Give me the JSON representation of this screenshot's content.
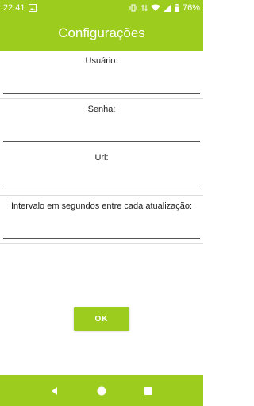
{
  "status_bar": {
    "time": "22:41",
    "battery": "76%",
    "icons": [
      "image-notification-icon",
      "vibrate-icon",
      "lte-signal-icon",
      "wifi-icon",
      "cell-signal-icon",
      "battery-icon"
    ]
  },
  "app_bar": {
    "title": "Configurações"
  },
  "form": {
    "fields": [
      {
        "label": "Usuário:",
        "value": ""
      },
      {
        "label": "Senha:",
        "value": ""
      },
      {
        "label": "Url:",
        "value": ""
      },
      {
        "label": "Intervalo em segundos entre cada atualização:",
        "value": ""
      }
    ],
    "ok_label": "OK"
  },
  "nav_bar": {
    "icons": [
      "back-icon",
      "home-icon",
      "recents-icon"
    ]
  },
  "colors": {
    "accent": "#9ccc1d",
    "text": "#202020",
    "divider": "#dddddd"
  }
}
